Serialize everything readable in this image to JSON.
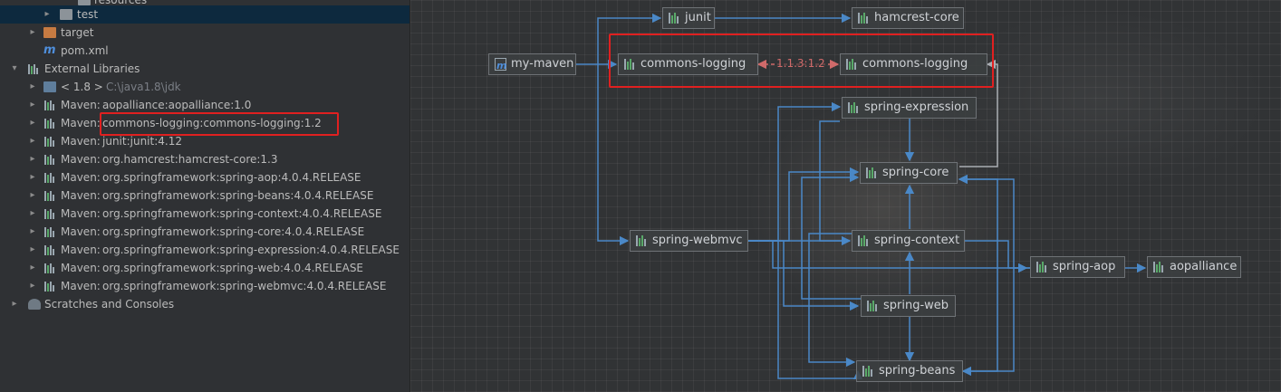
{
  "tree": {
    "items": [
      {
        "label": "resources",
        "icon": "folder-icon"
      },
      {
        "label": "test",
        "icon": "folder-icon"
      },
      {
        "label": "target",
        "icon": "folder-icon"
      },
      {
        "label": "pom.xml",
        "icon": "maven-file-icon"
      },
      {
        "label": "External Libraries",
        "icon": "library-icon"
      },
      {
        "label": "< 1.8 >",
        "path": "C:\\java1.8\\jdk",
        "icon": "jdk-icon"
      },
      {
        "prefix": "Maven:",
        "label": "aopalliance:aopalliance:1.0",
        "icon": "library-icon"
      },
      {
        "prefix": "Maven:",
        "label": "commons-logging:commons-logging:1.2",
        "icon": "library-icon"
      },
      {
        "prefix": "Maven:",
        "label": "junit:junit:4.12",
        "icon": "library-icon"
      },
      {
        "prefix": "Maven:",
        "label": "org.hamcrest:hamcrest-core:1.3",
        "icon": "library-icon"
      },
      {
        "prefix": "Maven:",
        "label": "org.springframework:spring-aop:4.0.4.RELEASE",
        "icon": "library-icon"
      },
      {
        "prefix": "Maven:",
        "label": "org.springframework:spring-beans:4.0.4.RELEASE",
        "icon": "library-icon"
      },
      {
        "prefix": "Maven:",
        "label": "org.springframework:spring-context:4.0.4.RELEASE",
        "icon": "library-icon"
      },
      {
        "prefix": "Maven:",
        "label": "org.springframework:spring-core:4.0.4.RELEASE",
        "icon": "library-icon"
      },
      {
        "prefix": "Maven:",
        "label": "org.springframework:spring-expression:4.0.4.RELEASE",
        "icon": "library-icon"
      },
      {
        "prefix": "Maven:",
        "label": "org.springframework:spring-web:4.0.4.RELEASE",
        "icon": "library-icon"
      },
      {
        "prefix": "Maven:",
        "label": "org.springframework:spring-webmvc:4.0.4.RELEASE",
        "icon": "library-icon"
      },
      {
        "label": "Scratches and Consoles",
        "icon": "scratches-icon"
      }
    ]
  },
  "diagram": {
    "nodes": {
      "my_maven": "my-maven",
      "junit": "junit",
      "hamcrest_core": "hamcrest-core",
      "commons_logging_left": "commons-logging",
      "commons_logging_right": "commons-logging",
      "spring_expression": "spring-expression",
      "spring_core": "spring-core",
      "spring_webmvc": "spring-webmvc",
      "spring_context": "spring-context",
      "spring_web": "spring-web",
      "spring_beans": "spring-beans",
      "spring_aop": "spring-aop",
      "aopalliance": "aopalliance"
    },
    "conflict_label": "1.1.3:1.2"
  },
  "colors": {
    "edge": "#4a88c7",
    "conflict": "#d06a6a",
    "highlight": "#e02020",
    "selected_row": "#0d293e"
  }
}
